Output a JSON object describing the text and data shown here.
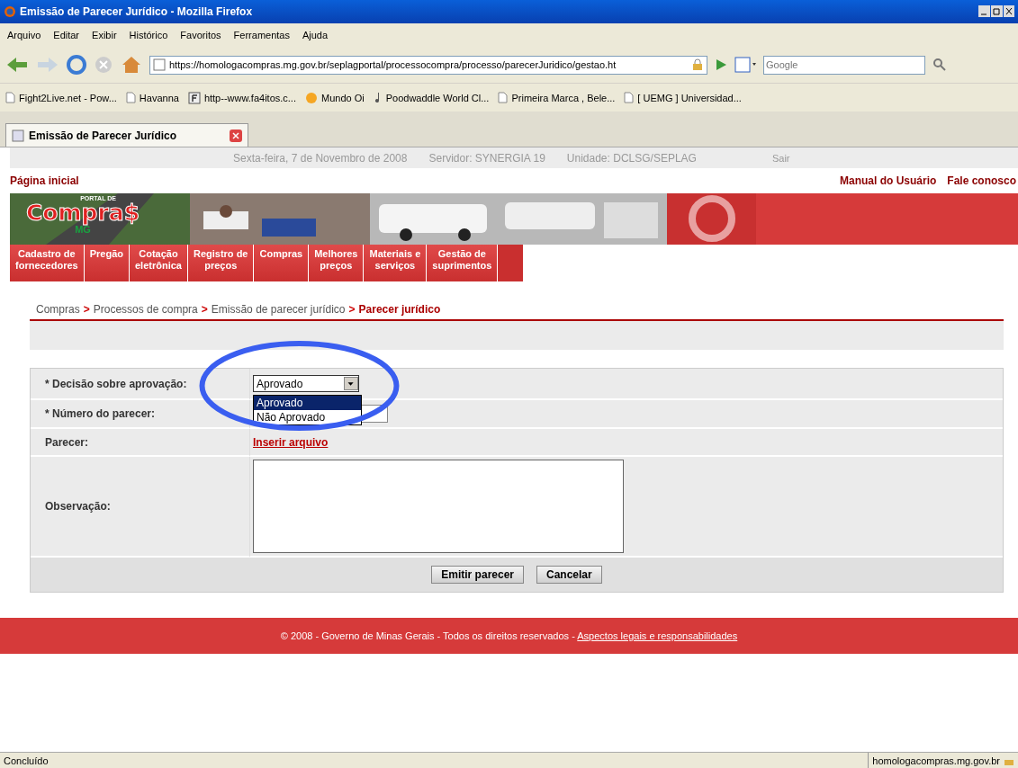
{
  "window": {
    "title": "Emissão de Parecer Jurídico - Mozilla Firefox"
  },
  "menu": [
    "Arquivo",
    "Editar",
    "Exibir",
    "Histórico",
    "Favoritos",
    "Ferramentas",
    "Ajuda"
  ],
  "address": {
    "value": "https://homologacompras.mg.gov.br/seplagportal/processocompra/processo/parecerJuridico/gestao.ht"
  },
  "search": {
    "placeholder": "Google"
  },
  "bookmarks": [
    {
      "label": "Fight2Live.net - Pow...",
      "kind": "page"
    },
    {
      "label": "Havanna",
      "kind": "page"
    },
    {
      "label": "http--www.fa4itos.c...",
      "kind": "square"
    },
    {
      "label": "Mundo Oi",
      "kind": "sun"
    },
    {
      "label": "Poodwaddle World Cl...",
      "kind": "note"
    },
    {
      "label": "Primeira Marca , Bele...",
      "kind": "page"
    },
    {
      "label": "[ UEMG ] Universidad...",
      "kind": "page"
    }
  ],
  "tabs": [
    {
      "label": "Emissão de Parecer Jurídico",
      "selected": true
    }
  ],
  "header": {
    "date": "Sexta-feira, 7 de Novembro de 2008",
    "server": "Servidor: SYNERGIA 19",
    "unit": "Unidade: DCLSG/SEPLAG",
    "logout": "Sair"
  },
  "home_link": "Página inicial",
  "top_links": [
    "Manual do Usuário",
    "Fale conosco"
  ],
  "logo": {
    "top": "PORTAL DE",
    "main": "Compra$",
    "sub": "MG"
  },
  "nav": [
    "Cadastro de\nfornecedores",
    "Pregão",
    "Cotação\neletrônica",
    "Registro de\npreços",
    "Compras",
    "Melhores\npreços",
    "Materiais e\nserviços",
    "Gestão de\nsuprimentos"
  ],
  "breadcrumb": {
    "separator": ">",
    "items": [
      {
        "label": "Compras",
        "current": false
      },
      {
        "label": "Processos de compra",
        "current": false
      },
      {
        "label": "Emissão de parecer jurídico",
        "current": false
      },
      {
        "label": "Parecer jurídico",
        "current": true
      }
    ]
  },
  "form": [
    {
      "kind": "select",
      "label": "* Decisão sobre aprovação:",
      "value": "Aprovado",
      "expanded": true,
      "options": [
        {
          "label": "Aprovado",
          "selected": true
        },
        {
          "label": "Não Aprovado",
          "selected": false
        }
      ]
    },
    {
      "kind": "input",
      "label": "* Número do parecer:"
    },
    {
      "kind": "link",
      "label": "Parecer:",
      "link": "Inserir arquivo"
    },
    {
      "kind": "textarea",
      "label": "Observação:"
    }
  ],
  "buttons": [
    "Emitir parecer",
    "Cancelar"
  ],
  "footer": {
    "text": "© 2008 - Governo de Minas Gerais - Todos os direitos reservados - ",
    "link": "Aspectos legais e responsabilidades"
  },
  "status_bar": {
    "status": "Concluído",
    "host": "homologacompras.mg.gov.br"
  }
}
